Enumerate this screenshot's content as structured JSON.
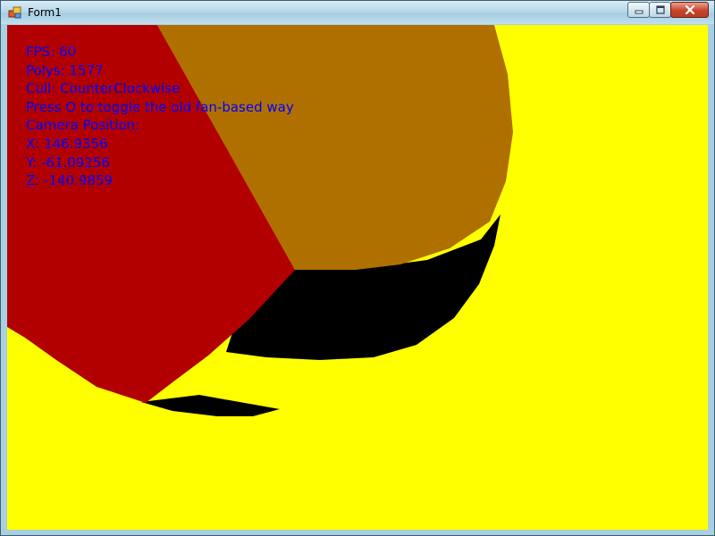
{
  "window": {
    "title": "Form1",
    "app_icon": "form-app-icon",
    "controls": [
      "minimize-icon",
      "maximize-icon",
      "close-icon"
    ]
  },
  "scene": {
    "background_color": "#ffff00",
    "shapes": [
      {
        "name": "brown-face",
        "color": "#b07000"
      },
      {
        "name": "red-face",
        "color": "#b20000"
      },
      {
        "name": "black-shadow",
        "color": "#000000"
      }
    ]
  },
  "overlay": {
    "color": "#0000ff",
    "fps": "FPS: 60",
    "polys": "Polys: 1577",
    "cull": "Cull: CounterClockwise",
    "toggle_hint": "Press O to toggle the old fan-based way",
    "camera_heading": "Camera Position:",
    "x": "X: 146.9356",
    "y": "Y: -61.09256",
    "z": "Z: -140.9859"
  }
}
